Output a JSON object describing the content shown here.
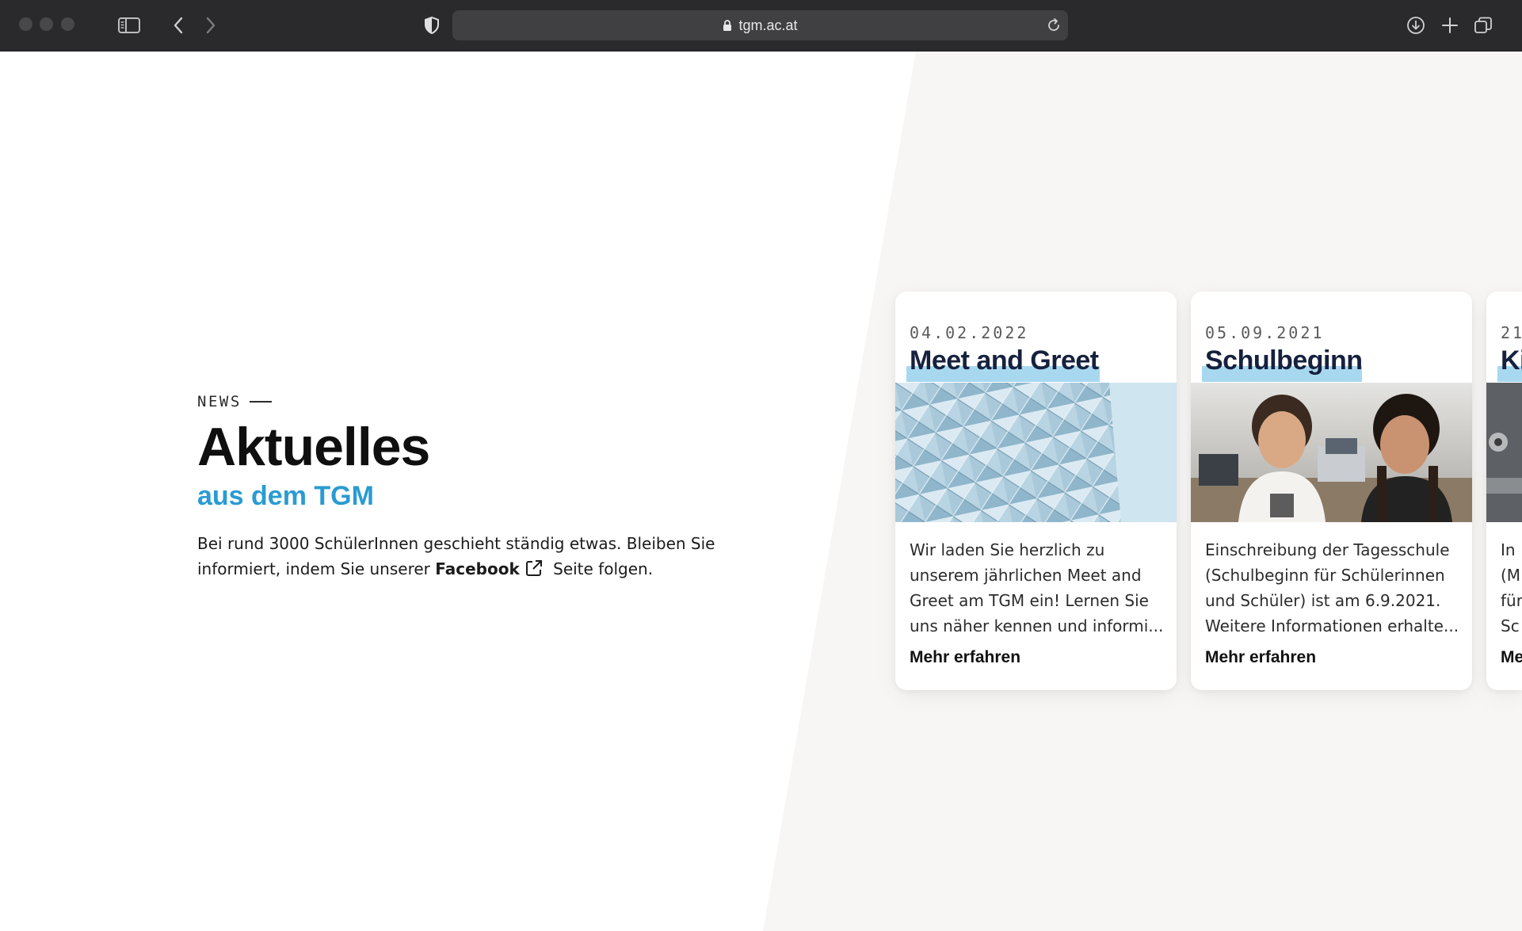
{
  "browser": {
    "url": "tgm.ac.at"
  },
  "intro": {
    "eyebrow": "NEWS",
    "headline": "Aktuelles",
    "subheadline": "aus dem TGM",
    "text_before": "Bei rund 3000 SchülerInnen geschieht ständig etwas. Bleiben Sie informiert, indem Sie unserer",
    "facebook_label": "Facebook",
    "text_after": "Seite folgen."
  },
  "cards": [
    {
      "date": "04.02.2022",
      "title": "Meet and Greet",
      "text": "Wir laden Sie herzlich zu unserem jährlichen Meet and Greet am TGM ein! Lernen Sie uns näher kennen und informi...",
      "link": "Mehr erfahren"
    },
    {
      "date": "05.09.2021",
      "title": "Schulbeginn",
      "text": "Einschreibung der Tagesschule (Schulbeginn für Schülerinnen und Schüler) ist am 6.9.2021. Weitere Informationen erhalte...",
      "link": "Mehr erfahren"
    },
    {
      "date": "21",
      "title": "Ki",
      "text": "In (M für Sc",
      "link": "Me"
    }
  ],
  "colors": {
    "accent": "#2a9bd2",
    "highlight": "#a8d8f0",
    "chrome": "#2a2a2c"
  }
}
